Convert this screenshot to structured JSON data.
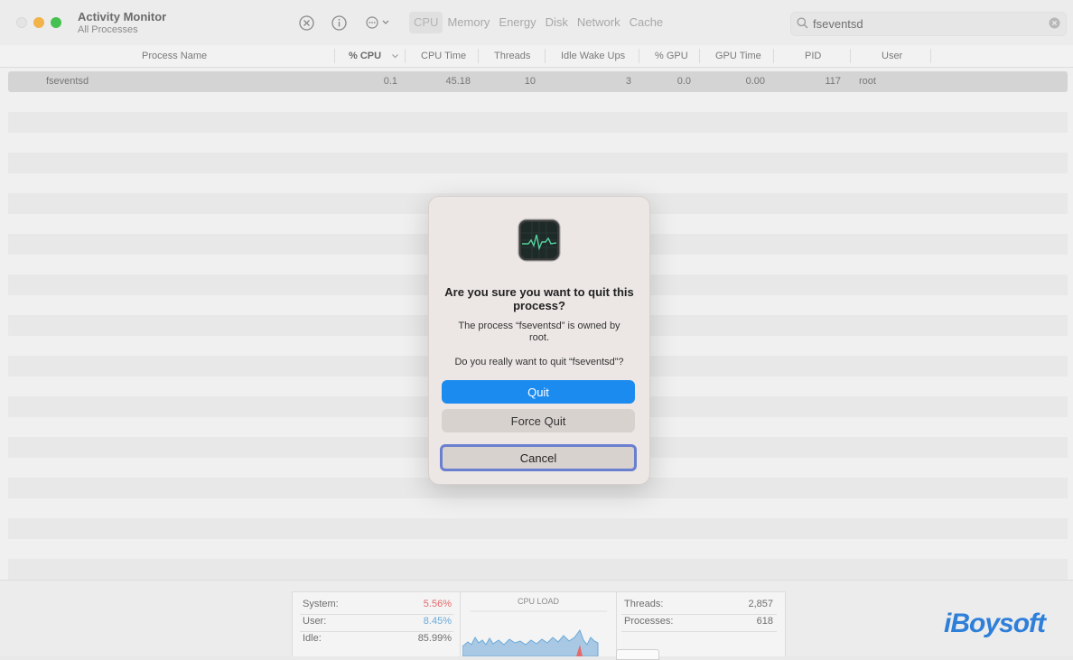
{
  "window": {
    "title": "Activity Monitor",
    "subtitle": "All Processes"
  },
  "toolbar": {
    "tabs": [
      {
        "label": "CPU",
        "active": true
      },
      {
        "label": "Memory",
        "active": false
      },
      {
        "label": "Energy",
        "active": false
      },
      {
        "label": "Disk",
        "active": false
      },
      {
        "label": "Network",
        "active": false
      },
      {
        "label": "Cache",
        "active": false
      }
    ]
  },
  "search": {
    "value": "fseventsd"
  },
  "table": {
    "columns": [
      "Process Name",
      "% CPU",
      "CPU Time",
      "Threads",
      "Idle Wake Ups",
      "% GPU",
      "GPU Time",
      "PID",
      "User"
    ],
    "rows": [
      {
        "name": "fseventsd",
        "cpu": "0.1",
        "cpu_time": "45.18",
        "threads": "10",
        "idle_wake_ups": "3",
        "gpu": "0.0",
        "gpu_time": "0.00",
        "pid": "117",
        "user": "root"
      }
    ]
  },
  "summary": {
    "system_label": "System:",
    "system_value": "5.56%",
    "user_label": "User:",
    "user_value": "8.45%",
    "idle_label": "Idle:",
    "idle_value": "85.99%",
    "cpu_load_label": "CPU LOAD",
    "threads_label": "Threads:",
    "threads_value": "2,857",
    "processes_label": "Processes:",
    "processes_value": "618"
  },
  "dialog": {
    "title": "Are you sure you want to quit this process?",
    "message": "The process “fseventsd” is owned by root.",
    "question": "Do you really want to quit “fseventsd”?",
    "quit_label": "Quit",
    "force_quit_label": "Force Quit",
    "cancel_label": "Cancel"
  },
  "watermark": {
    "text": "iBoysoft"
  },
  "colors": {
    "accent": "#1c8bf0",
    "system_red": "#e46a6a",
    "user_blue": "#6aaad8",
    "focus_ring": "#6a7fd0"
  }
}
